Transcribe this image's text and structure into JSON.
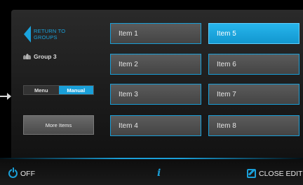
{
  "nav": {
    "back_label_line1": "RETURN TO",
    "back_label_line2": "GROUPS",
    "group_name": "Group 3"
  },
  "mode_toggle": {
    "options": [
      "Menu",
      "Manual"
    ],
    "selected": "Manual"
  },
  "more_items_label": "More Items",
  "items": [
    {
      "label": "Item 1",
      "selected": false
    },
    {
      "label": "Item 2",
      "selected": false
    },
    {
      "label": "Item 3",
      "selected": false
    },
    {
      "label": "Item 4",
      "selected": false
    },
    {
      "label": "Item 5",
      "selected": true
    },
    {
      "label": "Item 6",
      "selected": false
    },
    {
      "label": "Item 7",
      "selected": false
    },
    {
      "label": "Item 8",
      "selected": false
    }
  ],
  "footer": {
    "power_label": "OFF",
    "info_glyph": "i",
    "close_edit_label": "CLOSE EDIT"
  },
  "colors": {
    "accent": "#1a9fd8",
    "selected_item": "#1ea8e0",
    "background": "#000000"
  },
  "icons": {
    "back": "back-arrow-icon",
    "group": "group-icon",
    "power": "power-icon",
    "info": "info-icon",
    "edit": "edit-icon"
  }
}
